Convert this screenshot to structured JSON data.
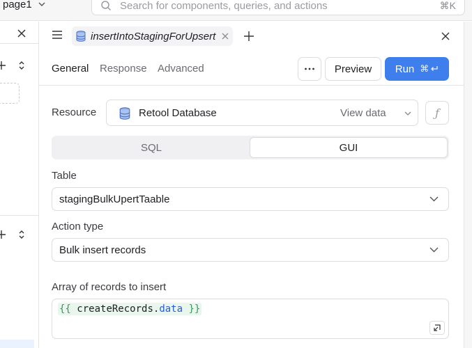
{
  "topbar": {
    "page_name": "page1",
    "search_placeholder": "Search for components, queries, and actions",
    "search_shortcut": "⌘K"
  },
  "editor": {
    "query_tab": {
      "name": "insertIntoStagingForUpsert"
    },
    "subtabs": [
      {
        "label": "General",
        "active": true
      },
      {
        "label": "Response",
        "active": false
      },
      {
        "label": "Advanced",
        "active": false
      }
    ],
    "actions": {
      "more_icon": "ellipsis-icon",
      "preview_label": "Preview",
      "run_label": "Run",
      "run_shortcut": "⌘"
    },
    "resource": {
      "label": "Resource",
      "value": "Retool Database",
      "view_data_label": "View data",
      "fx_label": "ƒ"
    },
    "mode": {
      "options": [
        "SQL",
        "GUI"
      ],
      "selected": "GUI"
    },
    "table": {
      "label": "Table",
      "value": "stagingBulkUpertTaable"
    },
    "action_type": {
      "label": "Action type",
      "value": "Bulk insert records"
    },
    "records": {
      "label": "Array of records to insert",
      "code_open": "{{",
      "code_ident": "createRecords",
      "code_dot": ".",
      "code_prop": "data",
      "code_close": "}}"
    }
  },
  "colors": {
    "accent": "#3e7fed",
    "code_bg": "#e8f6ee",
    "brace": "#2f9e5a",
    "prop": "#2c5bd6"
  }
}
